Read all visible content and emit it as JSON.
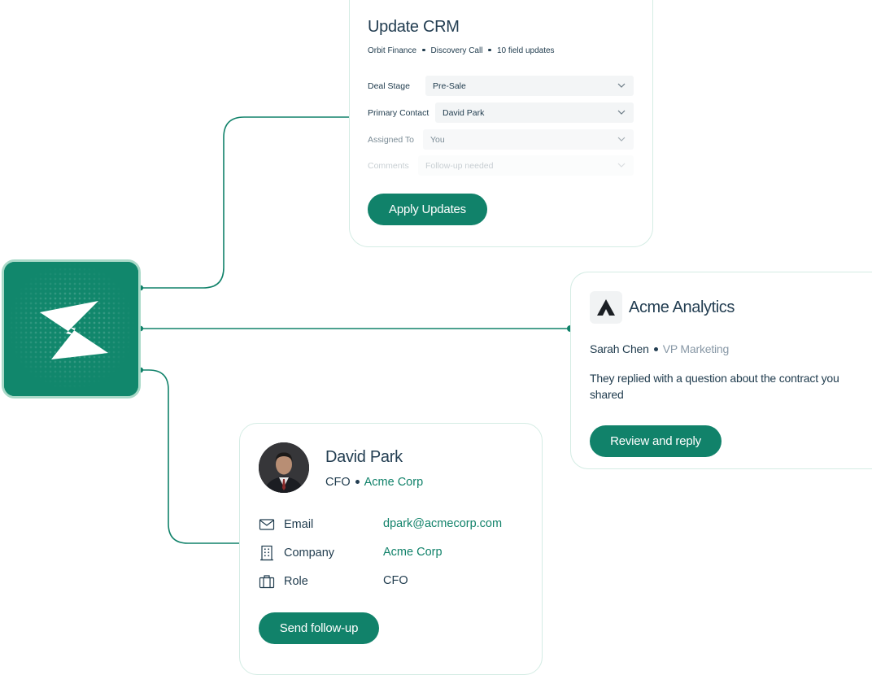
{
  "crm": {
    "title": "Update CRM",
    "meta": [
      "Orbit Finance",
      "Discovery Call",
      "10 field updates"
    ],
    "fields": [
      {
        "label": "Deal Stage",
        "value": "Pre-Sale"
      },
      {
        "label": "Primary Contact",
        "value": "David Park"
      },
      {
        "label": "Assigned To",
        "value": "You"
      },
      {
        "label": "Comments",
        "value": "Follow-up needed"
      }
    ],
    "apply_label": "Apply Updates"
  },
  "acme": {
    "company": "Acme Analytics",
    "person": "Sarah Chen",
    "role": "VP Marketing",
    "message": "They replied with a question about the contract you shared",
    "reply_label": "Review and reply"
  },
  "contact": {
    "name": "David Park",
    "title": "CFO",
    "company": "Acme Corp",
    "rows": [
      {
        "label": "Email",
        "value": "dpark@acmecorp.com"
      },
      {
        "label": "Company",
        "value": "Acme Corp"
      },
      {
        "label": "Role",
        "value": "CFO"
      }
    ],
    "followup_label": "Send follow-up"
  },
  "icons": {
    "brand": "lightning-bolt-icon",
    "email": "envelope-icon",
    "company": "building-icon",
    "role": "briefcase-icon",
    "chevron": "chevron-down-icon"
  },
  "colors": {
    "brand": "#11876c",
    "button": "#11826a",
    "accent": "#11826a",
    "card_border": "#d4ece4",
    "text": "#1f3b4d"
  }
}
